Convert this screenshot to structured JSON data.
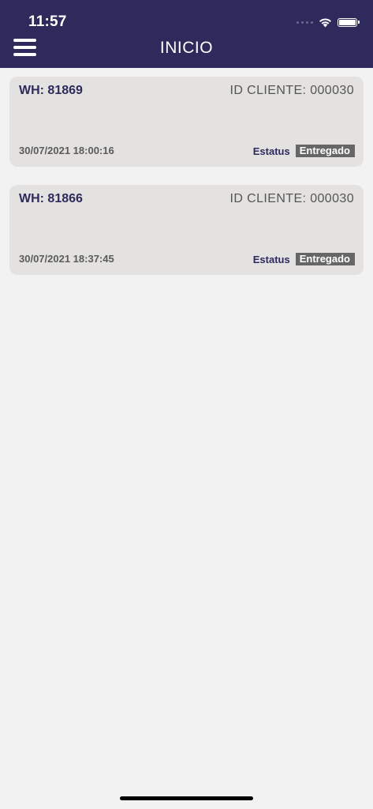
{
  "status_bar": {
    "time": "11:57"
  },
  "header": {
    "title": "INICIO",
    "menu_icon": "hamburger-menu-icon"
  },
  "orders": [
    {
      "wh": "WH: 81869",
      "client_id": "ID CLIENTE: 000030",
      "datetime": "30/07/2021 18:00:16",
      "status_label": "Estatus",
      "status_value": "Entregado"
    },
    {
      "wh": "WH: 81866",
      "client_id": "ID CLIENTE: 000030",
      "datetime": "30/07/2021 18:37:45",
      "status_label": "Estatus",
      "status_value": "Entregado"
    }
  ],
  "colors": {
    "header_bg": "#2e2a5c",
    "page_bg": "#f2f2f2",
    "card_bg": "#e3e2e0",
    "badge_bg": "#666666"
  }
}
